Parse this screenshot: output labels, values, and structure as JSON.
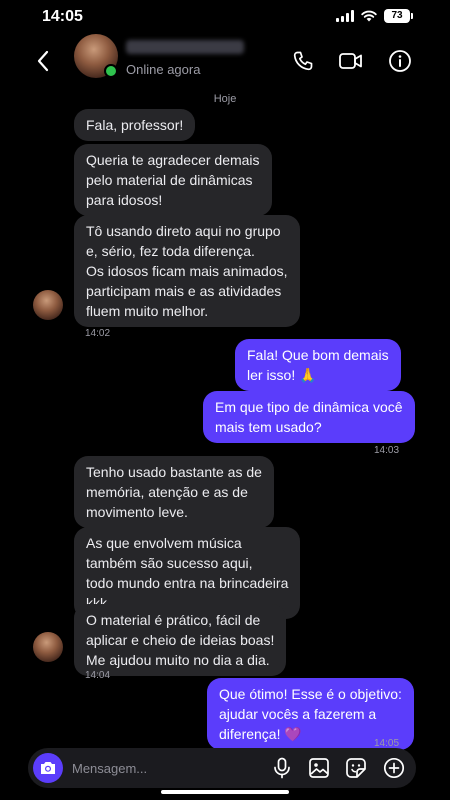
{
  "status_bar": {
    "time": "14:05",
    "battery": "73"
  },
  "header": {
    "online_status": "Online agora"
  },
  "chat": {
    "date_label": "Hoje",
    "messages": [
      {
        "text": "Fala, professor!"
      },
      {
        "text": "Queria te agradecer demais\npelo material de dinâmicas\npara idosos!"
      },
      {
        "text": "Tô usando direto aqui no grupo\ne, sério, fez toda diferença.\nOs idosos ficam mais animados,\nparticipam mais e as atividades\nfluem muito melhor."
      },
      {
        "text": "Fala! Que bom demais\nler isso! 🙏"
      },
      {
        "text": "Em que tipo de dinâmica você\nmais tem usado?"
      },
      {
        "text": "Tenho usado bastante as de\nmemória, atenção e as de\nmovimento leve."
      },
      {
        "text": "As que  envolvem música\ntambém são sucesso aqui,\ntodo mundo entra na brincadeira\nkkk"
      },
      {
        "text": "O material é prático, fácil de\naplicar e cheio de ideias boas!\nMe ajudou muito no dia a dia."
      },
      {
        "text": "Que ótimo! Esse é o objetivo:\najudar vocês a fazerem a\ndiferença! 💜"
      }
    ],
    "timestamps": [
      "14:02",
      "14:03",
      "14:04",
      "14:05"
    ]
  },
  "composer": {
    "placeholder": "Mensagem..."
  },
  "colors": {
    "accent": "#5b3dfb",
    "incoming_bubble": "#262629",
    "online": "#2fc24e",
    "background": "#000000"
  },
  "icons": [
    "back-chevron",
    "phone",
    "video-camera",
    "info",
    "camera",
    "microphone",
    "gallery",
    "sticker",
    "plus"
  ]
}
